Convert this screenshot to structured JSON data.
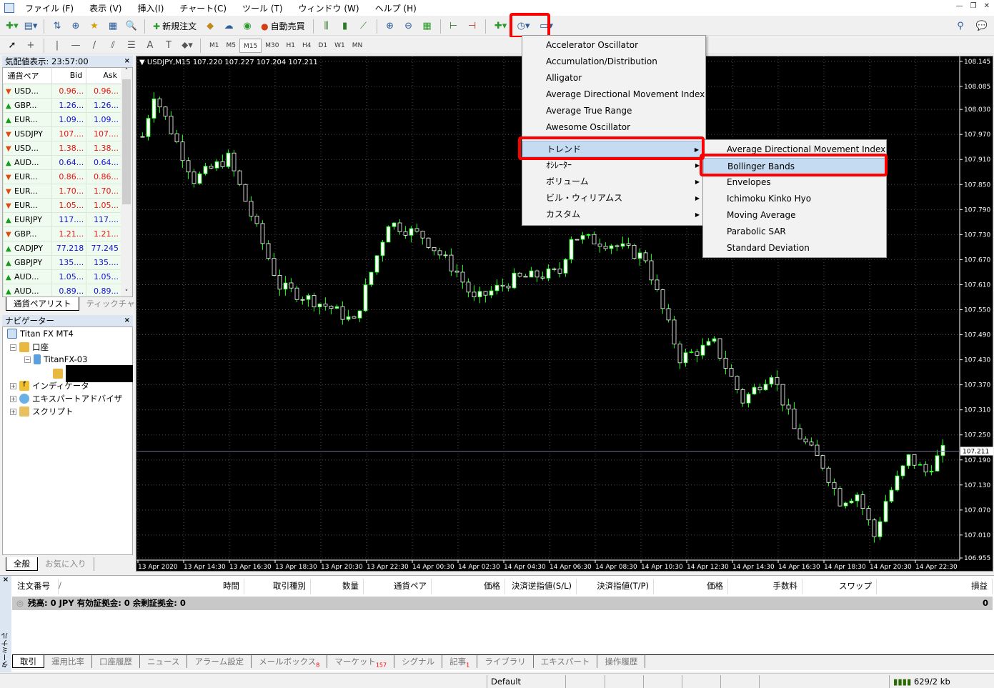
{
  "menubar": [
    "ファイル (F)",
    "表示 (V)",
    "挿入(I)",
    "チャート(C)",
    "ツール (T)",
    "ウィンドウ (W)",
    "ヘルプ (H)"
  ],
  "toolbar": {
    "new_order": "新規注文",
    "auto_trade": "自動売買",
    "timeframes": [
      "M1",
      "M5",
      "M15",
      "M30",
      "H1",
      "H4",
      "D1",
      "W1",
      "MN"
    ],
    "active_timeframe": "M15"
  },
  "market_watch": {
    "title": "気配値表示: 23:57:00",
    "columns": [
      "通貨ペア",
      "Bid",
      "Ask"
    ],
    "rows": [
      {
        "sym": "USD...",
        "bid": "0.96...",
        "ask": "0.96...",
        "dir": "down"
      },
      {
        "sym": "GBP...",
        "bid": "1.26...",
        "ask": "1.26...",
        "dir": "up"
      },
      {
        "sym": "EUR...",
        "bid": "1.09...",
        "ask": "1.09...",
        "dir": "up"
      },
      {
        "sym": "USDJPY",
        "bid": "107....",
        "ask": "107....",
        "dir": "down"
      },
      {
        "sym": "USD...",
        "bid": "1.38...",
        "ask": "1.38...",
        "dir": "down"
      },
      {
        "sym": "AUD...",
        "bid": "0.64...",
        "ask": "0.64...",
        "dir": "up"
      },
      {
        "sym": "EUR...",
        "bid": "0.86...",
        "ask": "0.86...",
        "dir": "down"
      },
      {
        "sym": "EUR...",
        "bid": "1.70...",
        "ask": "1.70...",
        "dir": "down"
      },
      {
        "sym": "EUR...",
        "bid": "1.05...",
        "ask": "1.05...",
        "dir": "down"
      },
      {
        "sym": "EURJPY",
        "bid": "117....",
        "ask": "117....",
        "dir": "up"
      },
      {
        "sym": "GBP...",
        "bid": "1.21...",
        "ask": "1.21...",
        "dir": "down"
      },
      {
        "sym": "CADJPY",
        "bid": "77.218",
        "ask": "77.245",
        "dir": "up"
      },
      {
        "sym": "GBPJPY",
        "bid": "135....",
        "ask": "135....",
        "dir": "up"
      },
      {
        "sym": "AUD...",
        "bid": "1.05...",
        "ask": "1.05...",
        "dir": "up"
      },
      {
        "sym": "AUD...",
        "bid": "0.89...",
        "ask": "0.89...",
        "dir": "up"
      }
    ],
    "tabs": [
      "通貨ペアリスト",
      "ティックチャート"
    ]
  },
  "navigator": {
    "title": "ナビゲーター",
    "root": "Titan FX MT4",
    "accounts": "口座",
    "account": "TitanFX-03",
    "indicators": "インディケータ",
    "experts": "エキスパートアドバイザ",
    "scripts": "スクリプト",
    "tabs": [
      "全般",
      "お気に入り"
    ]
  },
  "chart": {
    "header": "USDJPY,M15  107.220 107.227 107.204 107.211",
    "current_price": "107.211",
    "price_ticks": [
      "108.145",
      "108.085",
      "108.030",
      "107.970",
      "107.910",
      "107.850",
      "107.790",
      "107.730",
      "107.670",
      "107.610",
      "107.550",
      "107.490",
      "107.430",
      "107.370",
      "107.310",
      "107.250",
      "107.190",
      "107.130",
      "107.070",
      "107.010",
      "106.955"
    ],
    "time_ticks": [
      "13 Apr 2020",
      "13 Apr 14:30",
      "13 Apr 16:30",
      "13 Apr 18:30",
      "13 Apr 20:30",
      "13 Apr 22:30",
      "14 Apr 00:30",
      "14 Apr 02:30",
      "14 Apr 04:30",
      "14 Apr 06:30",
      "14 Apr 08:30",
      "14 Apr 10:30",
      "14 Apr 12:30",
      "14 Apr 14:30",
      "14 Apr 16:30",
      "14 Apr 18:30",
      "14 Apr 20:30",
      "14 Apr 22:30"
    ],
    "price_path": [
      [
        0,
        107.965
      ],
      [
        2,
        108.068
      ],
      [
        9,
        107.862
      ],
      [
        15,
        107.914
      ],
      [
        24,
        107.606
      ],
      [
        33,
        107.554
      ],
      [
        37,
        107.52
      ],
      [
        43,
        107.76
      ],
      [
        49,
        107.726
      ],
      [
        55,
        107.64
      ],
      [
        58,
        107.572
      ],
      [
        65,
        107.623
      ],
      [
        73,
        107.64
      ],
      [
        75,
        107.726
      ],
      [
        82,
        107.708
      ],
      [
        88,
        107.674
      ],
      [
        90,
        107.589
      ],
      [
        94,
        107.434
      ],
      [
        100,
        107.469
      ],
      [
        105,
        107.332
      ],
      [
        110,
        107.4
      ],
      [
        114,
        107.263
      ],
      [
        119,
        107.178
      ],
      [
        122,
        107.092
      ],
      [
        125,
        107.109
      ],
      [
        128,
        107.007
      ],
      [
        130,
        107.092
      ],
      [
        134,
        107.195
      ],
      [
        137,
        107.161
      ],
      [
        140,
        107.211
      ]
    ],
    "colors": {
      "bg": "#000000",
      "wick": "#00ff00",
      "bull": "#ffffff",
      "bear": "#000000",
      "grid": "#4a4a4a"
    }
  },
  "indicator_menu": {
    "items": [
      "Accelerator Oscillator",
      "Accumulation/Distribution",
      "Alligator",
      "Average Directional Movement Index",
      "Average True Range",
      "Awesome Oscillator"
    ],
    "groups": [
      "トレンド",
      "ｵｼﾚｰﾀｰ",
      "ボリューム",
      "ビル・ウィリアムス",
      "カスタム"
    ],
    "highlighted": "トレンド",
    "trend_submenu": [
      "Average Directional Movement Index",
      "Bollinger Bands",
      "Envelopes",
      "Ichimoku Kinko Hyo",
      "Moving Average",
      "Parabolic SAR",
      "Standard Deviation"
    ],
    "trend_highlighted": "Bollinger Bands"
  },
  "terminal": {
    "side_label": "ターミナル",
    "columns": [
      "注文番号",
      "時間",
      "取引種別",
      "数量",
      "通貨ペア",
      "価格",
      "決済逆指値(S/L)",
      "決済指値(T/P)",
      "価格",
      "手数料",
      "スワップ",
      "損益"
    ],
    "sort_mark": "/",
    "balance": "残高: 0 JPY  有効証拠金: 0  余剰証拠金: 0",
    "profit": "0",
    "tabs": [
      {
        "label": "取引"
      },
      {
        "label": "運用比率"
      },
      {
        "label": "口座履歴"
      },
      {
        "label": "ニュース"
      },
      {
        "label": "アラーム設定"
      },
      {
        "label": "メールボックス",
        "badge": "8"
      },
      {
        "label": "マーケット",
        "badge": "157"
      },
      {
        "label": "シグナル"
      },
      {
        "label": "記事",
        "badge": "1"
      },
      {
        "label": "ライブラリ"
      },
      {
        "label": "エキスパート"
      },
      {
        "label": "操作履歴"
      }
    ]
  },
  "status": {
    "profile": "Default",
    "traffic": "629/2 kb"
  },
  "accent": {
    "highlight_box": "#ff0000",
    "menu_highlight": "#c5dbf1"
  }
}
